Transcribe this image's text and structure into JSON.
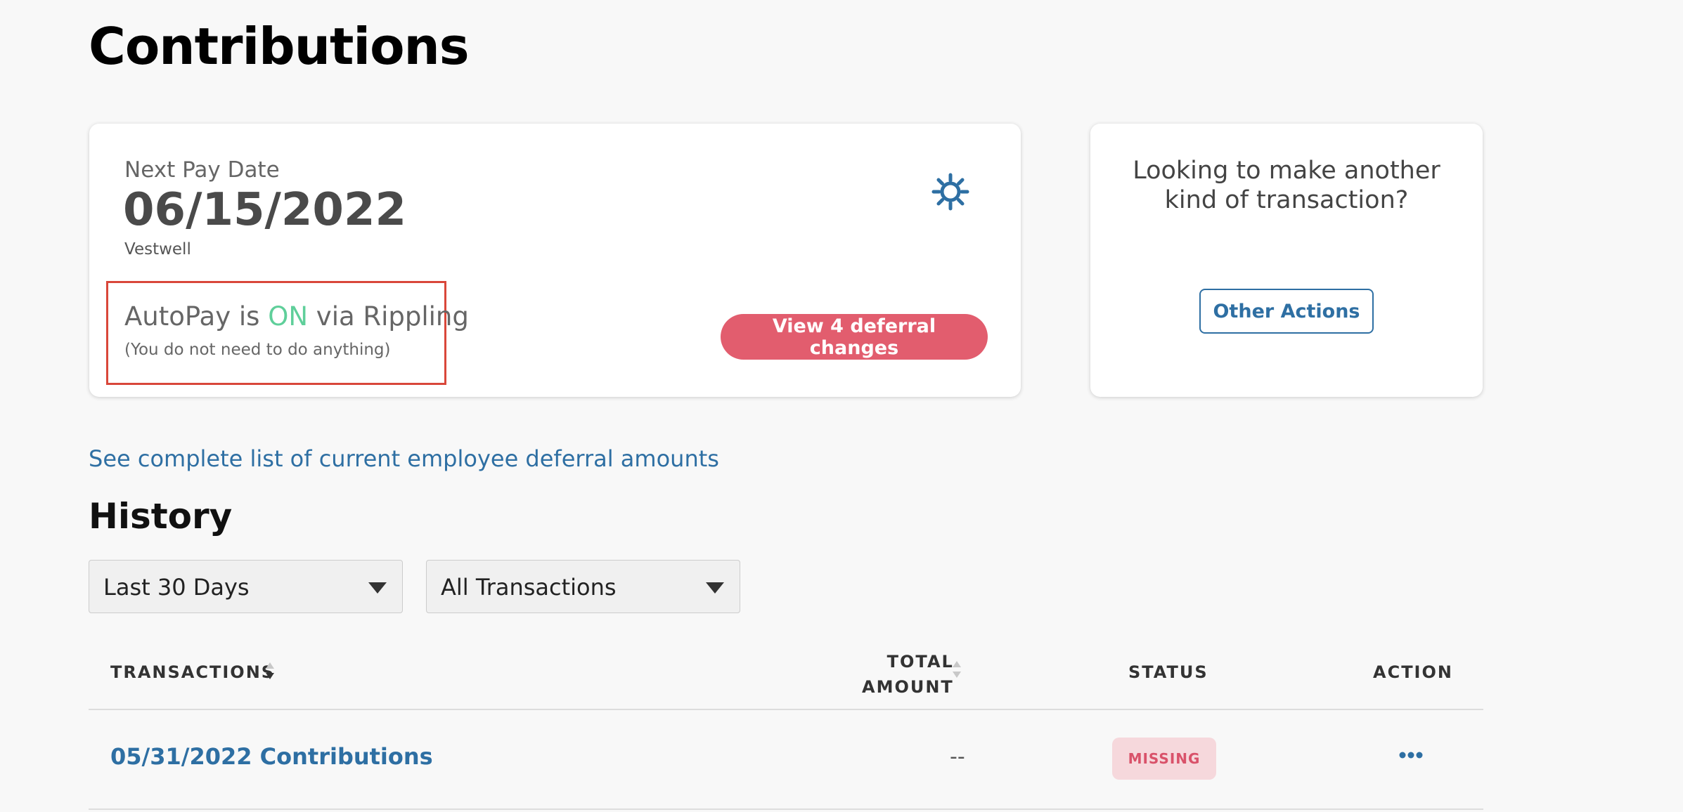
{
  "page": {
    "title": "Contributions"
  },
  "pay_card": {
    "next_pay_label": "Next Pay Date",
    "next_pay_date": "06/15/2022",
    "provider": "Vestwell",
    "autopay_prefix": "AutoPay is ",
    "autopay_status": "ON",
    "autopay_suffix": " via Rippling",
    "autopay_note": "(You do not need to do anything)",
    "deferral_button": "View 4 deferral changes",
    "settings_icon": "gear-icon"
  },
  "other_card": {
    "title_line1": "Looking to make another",
    "title_line2": "kind of transaction?",
    "button": "Other Actions"
  },
  "deferral_link": "See complete list of current employee deferral amounts",
  "history": {
    "title": "History",
    "range_select": "Last 30 Days",
    "type_select": "All Transactions",
    "columns": {
      "transactions": "TRANSACTIONS",
      "total_line1": "TOTAL",
      "total_line2": "AMOUNT",
      "status": "STATUS",
      "action": "ACTION"
    },
    "rows": [
      {
        "transaction": "05/31/2022 Contributions",
        "total": "--",
        "status": "MISSING"
      }
    ]
  },
  "colors": {
    "accent_blue": "#2e6fa3",
    "deferral_button": "#e25d6e",
    "autopay_on": "#5fcf9a",
    "missing_badge_bg": "#f6d8dc",
    "missing_badge_text": "#d9526a"
  }
}
